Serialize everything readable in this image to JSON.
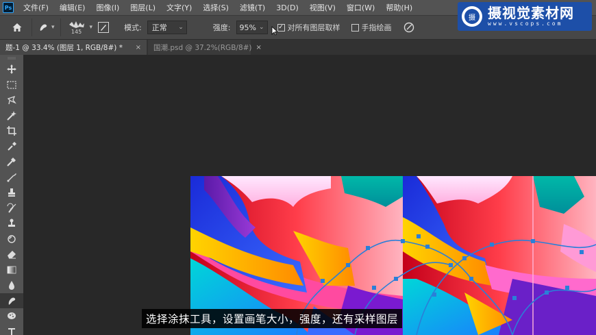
{
  "menubar": {
    "app_logo": "Ps",
    "items": [
      "文件(F)",
      "编辑(E)",
      "图像(I)",
      "图层(L)",
      "文字(Y)",
      "选择(S)",
      "滤镜(T)",
      "3D(D)",
      "视图(V)",
      "窗口(W)",
      "帮助(H)"
    ]
  },
  "watermark": {
    "name": "摄视觉素材网",
    "url": "www.vscops.com"
  },
  "options": {
    "brush_size": "145",
    "mode_label": "模式:",
    "mode_value": "正常",
    "strength_label": "强度:",
    "strength_value": "95%",
    "sample_all_layers_label": "对所有图层取样",
    "sample_all_layers_checked": "✓",
    "finger_painting_label": "手指绘画"
  },
  "tabs": [
    {
      "label": "题-1 @ 33.4% (图层 1, RGB/8#) *",
      "close": "×"
    },
    {
      "label": "国潮.psd @ 37.2%(RGB/8#)",
      "close": "×"
    }
  ],
  "tools": [
    "move-icon",
    "marquee-icon",
    "lasso-icon",
    "magic-wand-icon",
    "crop-icon",
    "eyedropper-icon",
    "healing-brush-icon",
    "brush-icon",
    "clone-stamp-icon",
    "history-brush-icon",
    "stamp-icon",
    "eraser-alt-icon",
    "eraser-icon",
    "gradient-icon",
    "blur-icon",
    "smudge-icon",
    "sponge-icon",
    "type-icon"
  ],
  "subtitle": "选择涂抹工具，设置画笔大小，强度，还有采样图层",
  "colors": {
    "menubar_bg": "#535353",
    "options_bg": "#474747",
    "canvas_bg": "#282828",
    "watermark_bg": "#1d4fa8",
    "ps_accent": "#31a8ff"
  }
}
